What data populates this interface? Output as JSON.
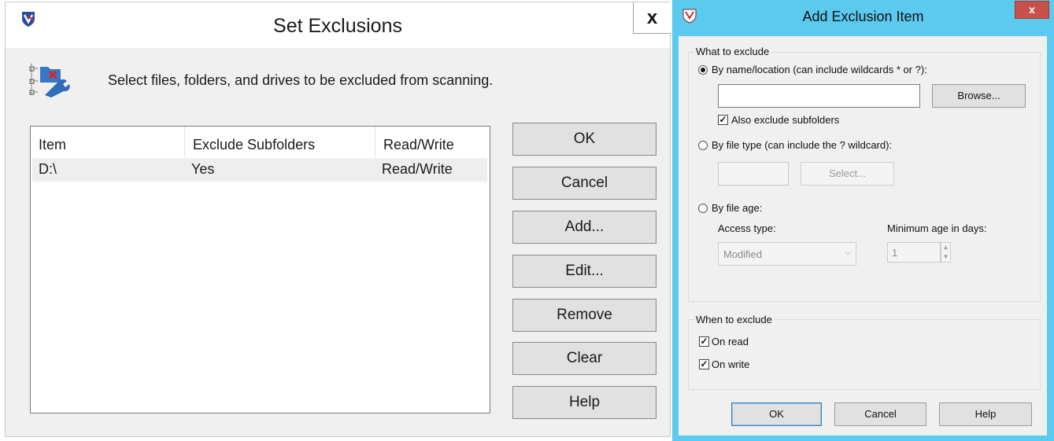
{
  "set_exclusions": {
    "title": "Set Exclusions",
    "close_label": "x",
    "description": "Select files, folders, and drives to be excluded from scanning.",
    "columns": [
      "Item",
      "Exclude Subfolders",
      "Read/Write"
    ],
    "rows": [
      {
        "item": "D:\\",
        "exclude_subfolders": "Yes",
        "read_write": "Read/Write"
      }
    ],
    "buttons": {
      "ok": "OK",
      "cancel": "Cancel",
      "add": "Add...",
      "edit": "Edit...",
      "remove": "Remove",
      "clear": "Clear",
      "help": "Help"
    }
  },
  "add_exclusion_item": {
    "title": "Add Exclusion Item",
    "close_label": "x",
    "what_group": {
      "title": "What to exclude",
      "by_name": {
        "label": "By name/location (can include wildcards * or ?):",
        "selected": true
      },
      "name_value": "",
      "browse_label": "Browse...",
      "also_subfolders": {
        "label": "Also exclude subfolders",
        "checked": true
      },
      "by_type": {
        "label": "By file type (can include the ? wildcard):",
        "selected": false
      },
      "type_value": "",
      "select_label": "Select...",
      "by_age": {
        "label": "By file age:",
        "selected": false
      },
      "access_type_label": "Access type:",
      "access_type_value": "Modified",
      "min_age_label": "Minimum age in days:",
      "min_age_value": "1"
    },
    "when_group": {
      "title": "When to exclude",
      "on_read": {
        "label": "On read",
        "checked": true
      },
      "on_write": {
        "label": "On write",
        "checked": true
      }
    },
    "buttons": {
      "ok": "OK",
      "cancel": "Cancel",
      "help": "Help"
    }
  },
  "colors": {
    "window_bg": "#f0f0f0",
    "dialog_frame": "#5cc9ef",
    "close_red": "#c7504b",
    "row_highlight": "#eeeeee"
  }
}
